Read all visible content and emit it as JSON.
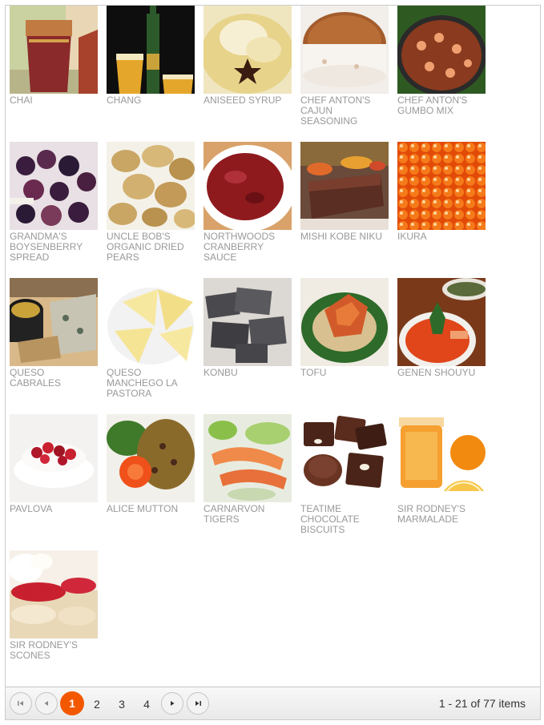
{
  "products": [
    {
      "name": "Chai",
      "icon": "chai-tea-glass-image"
    },
    {
      "name": "Chang",
      "icon": "chang-beer-image"
    },
    {
      "name": "Aniseed Syrup",
      "icon": "aniseed-syrup-image"
    },
    {
      "name": "Chef Anton's Cajun Seasoning",
      "icon": "cajun-seasoning-cake-image"
    },
    {
      "name": "Chef Anton's Gumbo Mix",
      "icon": "gumbo-mix-pan-image"
    },
    {
      "name": "Grandma's Boysenberry Spread",
      "icon": "boysenberry-image"
    },
    {
      "name": "Uncle Bob's Organic Dried Pears",
      "icon": "dried-pears-image"
    },
    {
      "name": "Northwoods Cranberry Sauce",
      "icon": "cranberry-sauce-image"
    },
    {
      "name": "Mishi Kobe Niku",
      "icon": "kobe-steak-image"
    },
    {
      "name": "Ikura",
      "icon": "ikura-roe-image"
    },
    {
      "name": "Queso Cabrales",
      "icon": "queso-cabrales-image"
    },
    {
      "name": "Queso Manchego La Pastora",
      "icon": "manchego-cheese-image"
    },
    {
      "name": "Konbu",
      "icon": "konbu-seaweed-image"
    },
    {
      "name": "Tofu",
      "icon": "tofu-dish-image"
    },
    {
      "name": "Genen Shouyu",
      "icon": "genen-shouyu-image"
    },
    {
      "name": "Pavlova",
      "icon": "pavlova-image"
    },
    {
      "name": "Alice Mutton",
      "icon": "alice-mutton-image"
    },
    {
      "name": "Carnarvon Tigers",
      "icon": "carnarvon-tigers-image"
    },
    {
      "name": "Teatime Chocolate Biscuits",
      "icon": "chocolate-biscuits-image"
    },
    {
      "name": "Sir Rodney's Marmalade",
      "icon": "marmalade-jar-image"
    },
    {
      "name": "Sir Rodney's Scones",
      "icon": "scones-image"
    }
  ],
  "pager": {
    "pages": [
      "1",
      "2",
      "3",
      "4"
    ],
    "current_page": "1",
    "info": "1 - 21 of 77 items"
  },
  "colors": {
    "accent": "#f35800",
    "label_text": "#999999",
    "border": "#cccccc"
  }
}
